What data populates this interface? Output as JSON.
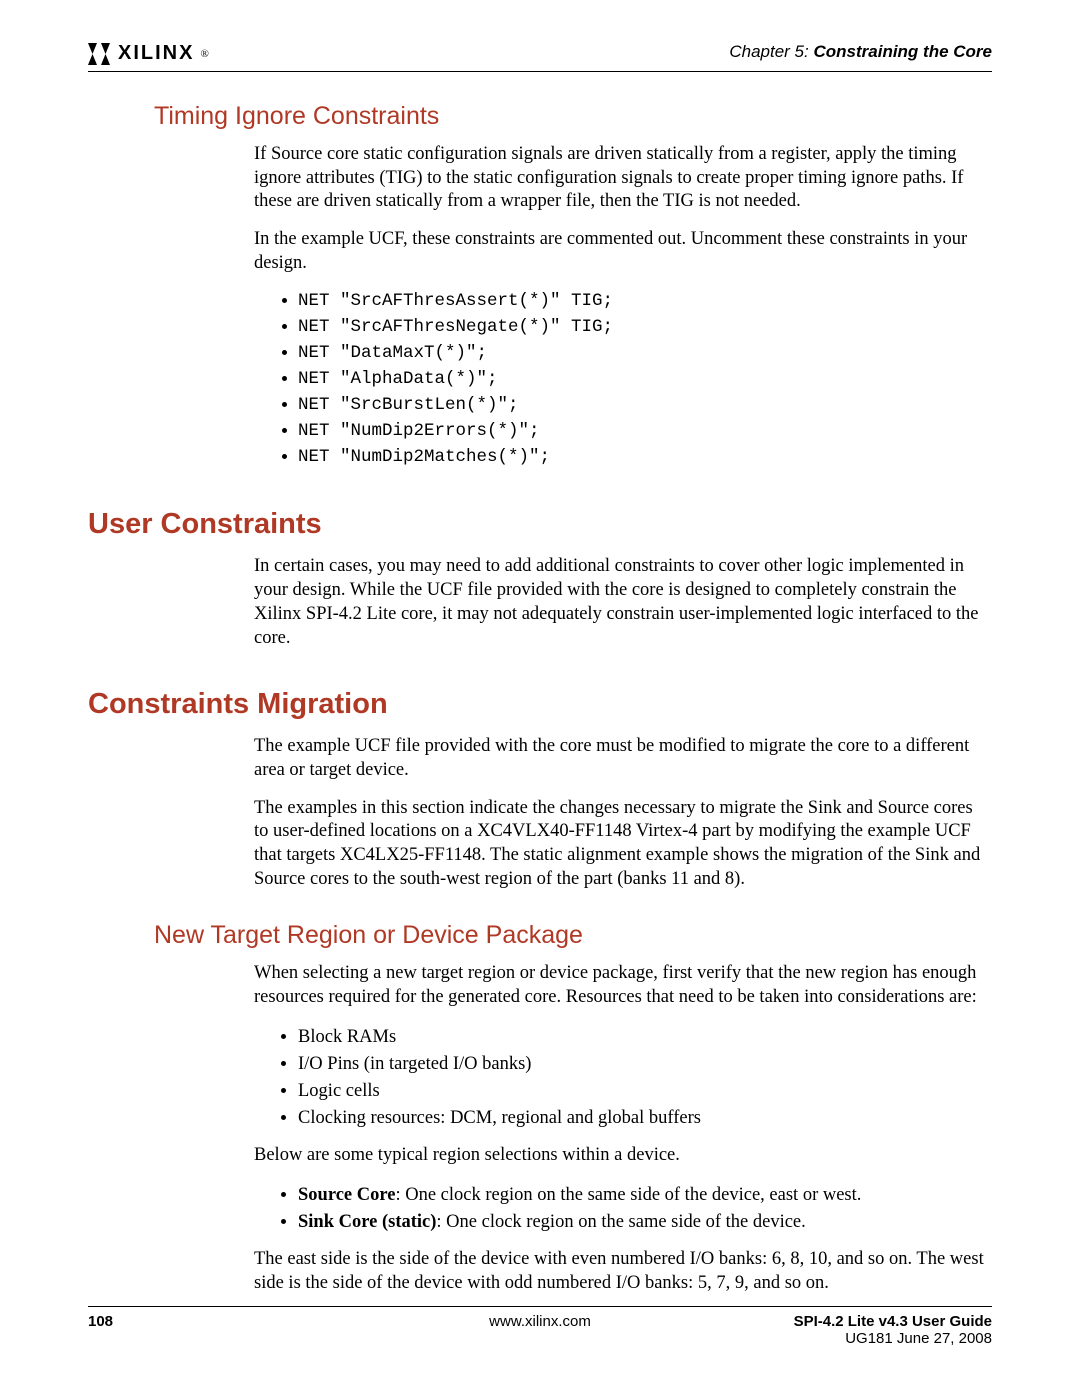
{
  "header": {
    "logo_text": "XILINX",
    "chapter_prefix": "Chapter 5:",
    "chapter_title": "Constraining the Core"
  },
  "s1": {
    "heading": "Timing Ignore Constraints",
    "p1": "If Source core static configuration signals are driven statically from a register, apply the timing ignore attributes (TIG) to the static configuration signals to create proper timing ignore paths. If these are driven statically from a wrapper file, then the TIG is not needed.",
    "p2": "In the example UCF, these constraints are commented out. Uncomment these constraints in your design.",
    "items": [
      "NET \"SrcAFThresAssert(*)\"  TIG;",
      "NET \"SrcAFThresNegate(*)\"  TIG;",
      "NET \"DataMaxT(*)\";",
      "NET \"AlphaData(*)\";",
      "NET \"SrcBurstLen(*)\";",
      "NET \"NumDip2Errors(*)\";",
      "NET \"NumDip2Matches(*)\";"
    ]
  },
  "s2": {
    "heading": "User Constraints",
    "p1": "In certain cases, you may need to add additional constraints to cover other logic implemented in your design. While the UCF file provided with the core is designed to completely constrain the Xilinx SPI-4.2 Lite core, it may not adequately constrain user-implemented logic interfaced to the core."
  },
  "s3": {
    "heading": "Constraints Migration",
    "p1": "The example UCF file provided with the core must be modified to migrate the core to a different area or target device.",
    "p2": "The examples in this section indicate the changes necessary to migrate the Sink and Source cores to user-defined locations on a XC4VLX40-FF1148 Virtex-4 part by modifying the example UCF that targets XC4LX25-FF1148. The static alignment example shows the migration of the Sink and Source cores to the south-west region of the part (banks 11 and 8)."
  },
  "s4": {
    "heading": "New Target Region or Device Package",
    "p1": "When selecting a new target region or device package, first verify that the new region has enough resources required for the generated core. Resources that need to be taken into considerations are:",
    "resources": [
      "Block RAMs",
      "I/O Pins (in targeted I/O banks)",
      "Logic cells",
      "Clocking resources: DCM, regional and global buffers"
    ],
    "p2": "Below are some typical region selections within a device.",
    "regions": [
      {
        "b": "Source Core",
        "t": ": One clock region on the same side of the device, east or west."
      },
      {
        "b": "Sink Core (static)",
        "t": ": One clock region on the same side of the device."
      }
    ],
    "p3": "The east side is the side of the device with even numbered I/O banks: 6, 8, 10, and so on. The west side is the side of the device with odd numbered I/O banks: 5, 7, 9, and so on."
  },
  "footer": {
    "page": "108",
    "url": "www.xilinx.com",
    "title": "SPI-4.2 Lite v4.3 User Guide",
    "doc": "UG181 June 27, 2008"
  }
}
